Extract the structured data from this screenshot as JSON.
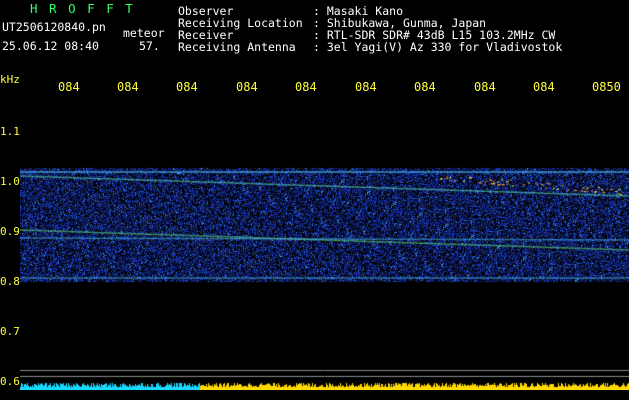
{
  "header": {
    "brand": "H R O F F T",
    "filename": "UT2506120840.pn",
    "meteor_label": "meteor",
    "datetime": "25.06.12 08:40",
    "count": "57.",
    "fields": [
      {
        "label": "Observer",
        "value": ": Masaki Kano"
      },
      {
        "label": "Receiving Location",
        "value": ": Shibukawa, Gunma, Japan"
      },
      {
        "label": "Receiver",
        "value": ": RTL-SDR SDR# 43dB L15 103.2MHz CW"
      },
      {
        "label": "Receiving Antenna",
        "value": ": 3el Yagi(V) Az 330 for Vladivostok"
      }
    ]
  },
  "time_ticks": [
    "084",
    "084",
    "084",
    "084",
    "084",
    "084",
    "084",
    "084",
    "084",
    "0850"
  ],
  "y_axis": {
    "unit": "kHz",
    "labels": [
      "1.1",
      "1.0",
      "0.9",
      "0.8",
      "0.7",
      "0.6"
    ]
  },
  "colors": {
    "label_yellow": "#ffff3a",
    "brand_green": "#33ff66",
    "text_white": "#ffffff",
    "band_blue": "#1e3aff",
    "bottom_bar_cyan": "#18d8ff",
    "bottom_bar_yellow": "#ffd800"
  }
}
